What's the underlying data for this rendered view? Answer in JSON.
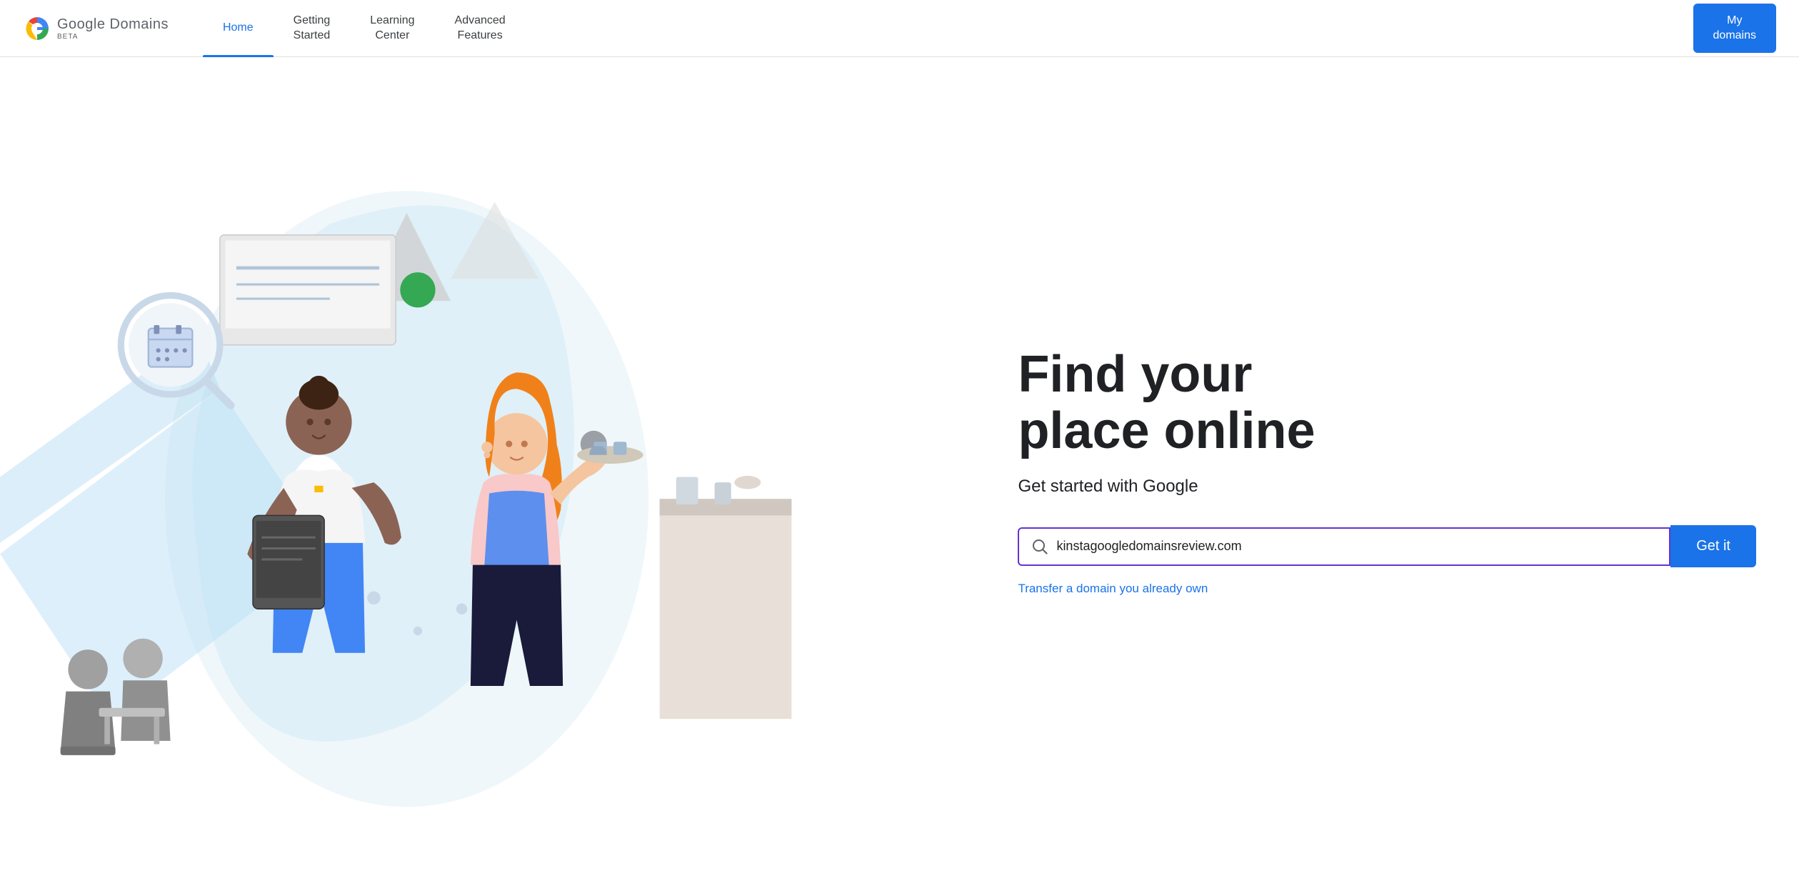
{
  "header": {
    "logo_name": "Google Domains",
    "logo_beta": "BETA",
    "nav": [
      {
        "id": "home",
        "label": "Home",
        "active": true
      },
      {
        "id": "getting-started",
        "label": "Getting\nStarted",
        "active": false
      },
      {
        "id": "learning-center",
        "label": "Learning\nCenter",
        "active": false
      },
      {
        "id": "advanced-features",
        "label": "Advanced\nFeatures",
        "active": false
      }
    ],
    "my_domains_label": "My\ndomains"
  },
  "main": {
    "headline": "Find your\nplace online",
    "subheadline": "Get started with Google",
    "search_placeholder": "kinstagoogledomainsreview.com",
    "search_value": "kinstagoogledomainsreview.com",
    "get_it_label": "Get it",
    "transfer_link": "Transfer a domain you already own"
  },
  "icons": {
    "search": "🔍",
    "google_colors": {
      "blue": "#4285F4",
      "red": "#EA4335",
      "yellow": "#FBBC05",
      "green": "#34A853"
    }
  }
}
